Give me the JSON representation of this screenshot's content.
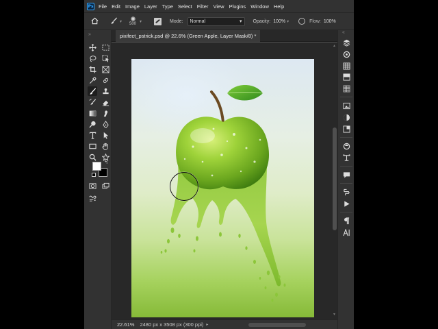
{
  "app": {
    "logo_text": "Ps"
  },
  "menu": [
    "File",
    "Edit",
    "Image",
    "Layer",
    "Type",
    "Select",
    "Filter",
    "View",
    "Plugins",
    "Window",
    "Help"
  ],
  "options": {
    "brush_size": "500",
    "mode_label": "Mode:",
    "mode_value": "Normal",
    "opacity_label": "Opacity:",
    "opacity_value": "100%",
    "flow_label": "Flow:",
    "flow_value": "100%"
  },
  "document": {
    "tab_title": "pixifect_pstrick.psd @ 22.6% (Green Apple, Layer Mask/8) *",
    "zoom": "22.61%",
    "size_info": "2480 px x 3508 px (300 ppi)"
  },
  "colors": {
    "foreground": "#ffffff",
    "background": "#000000",
    "accent": "#31a8ff"
  },
  "tools": [
    "move-icon",
    "marquee-icon",
    "lasso-icon",
    "object-select-icon",
    "crop-icon",
    "frame-icon",
    "eyedropper-icon",
    "healing-icon",
    "brush-icon",
    "stamp-icon",
    "history-brush-icon",
    "eraser-icon",
    "gradient-icon",
    "smudge-icon",
    "dodge-icon",
    "pen-icon",
    "type-icon",
    "path-select-icon",
    "rectangle-icon",
    "hand-icon",
    "zoom-icon",
    "star-icon",
    "quick-mask-icon",
    "screen-mode-icon",
    "edit-toolbar-icon"
  ],
  "right_panel_icons": [
    "layers-icon",
    "channels-icon",
    "swatches-icon",
    "gradients-icon",
    "patterns-icon",
    "libraries-icon",
    "adjustments-icon",
    "properties-icon",
    "navigator-icon",
    "paths-icon",
    "comments-icon",
    "history-icon",
    "actions-icon",
    "paragraph-icon",
    "character-icon"
  ]
}
